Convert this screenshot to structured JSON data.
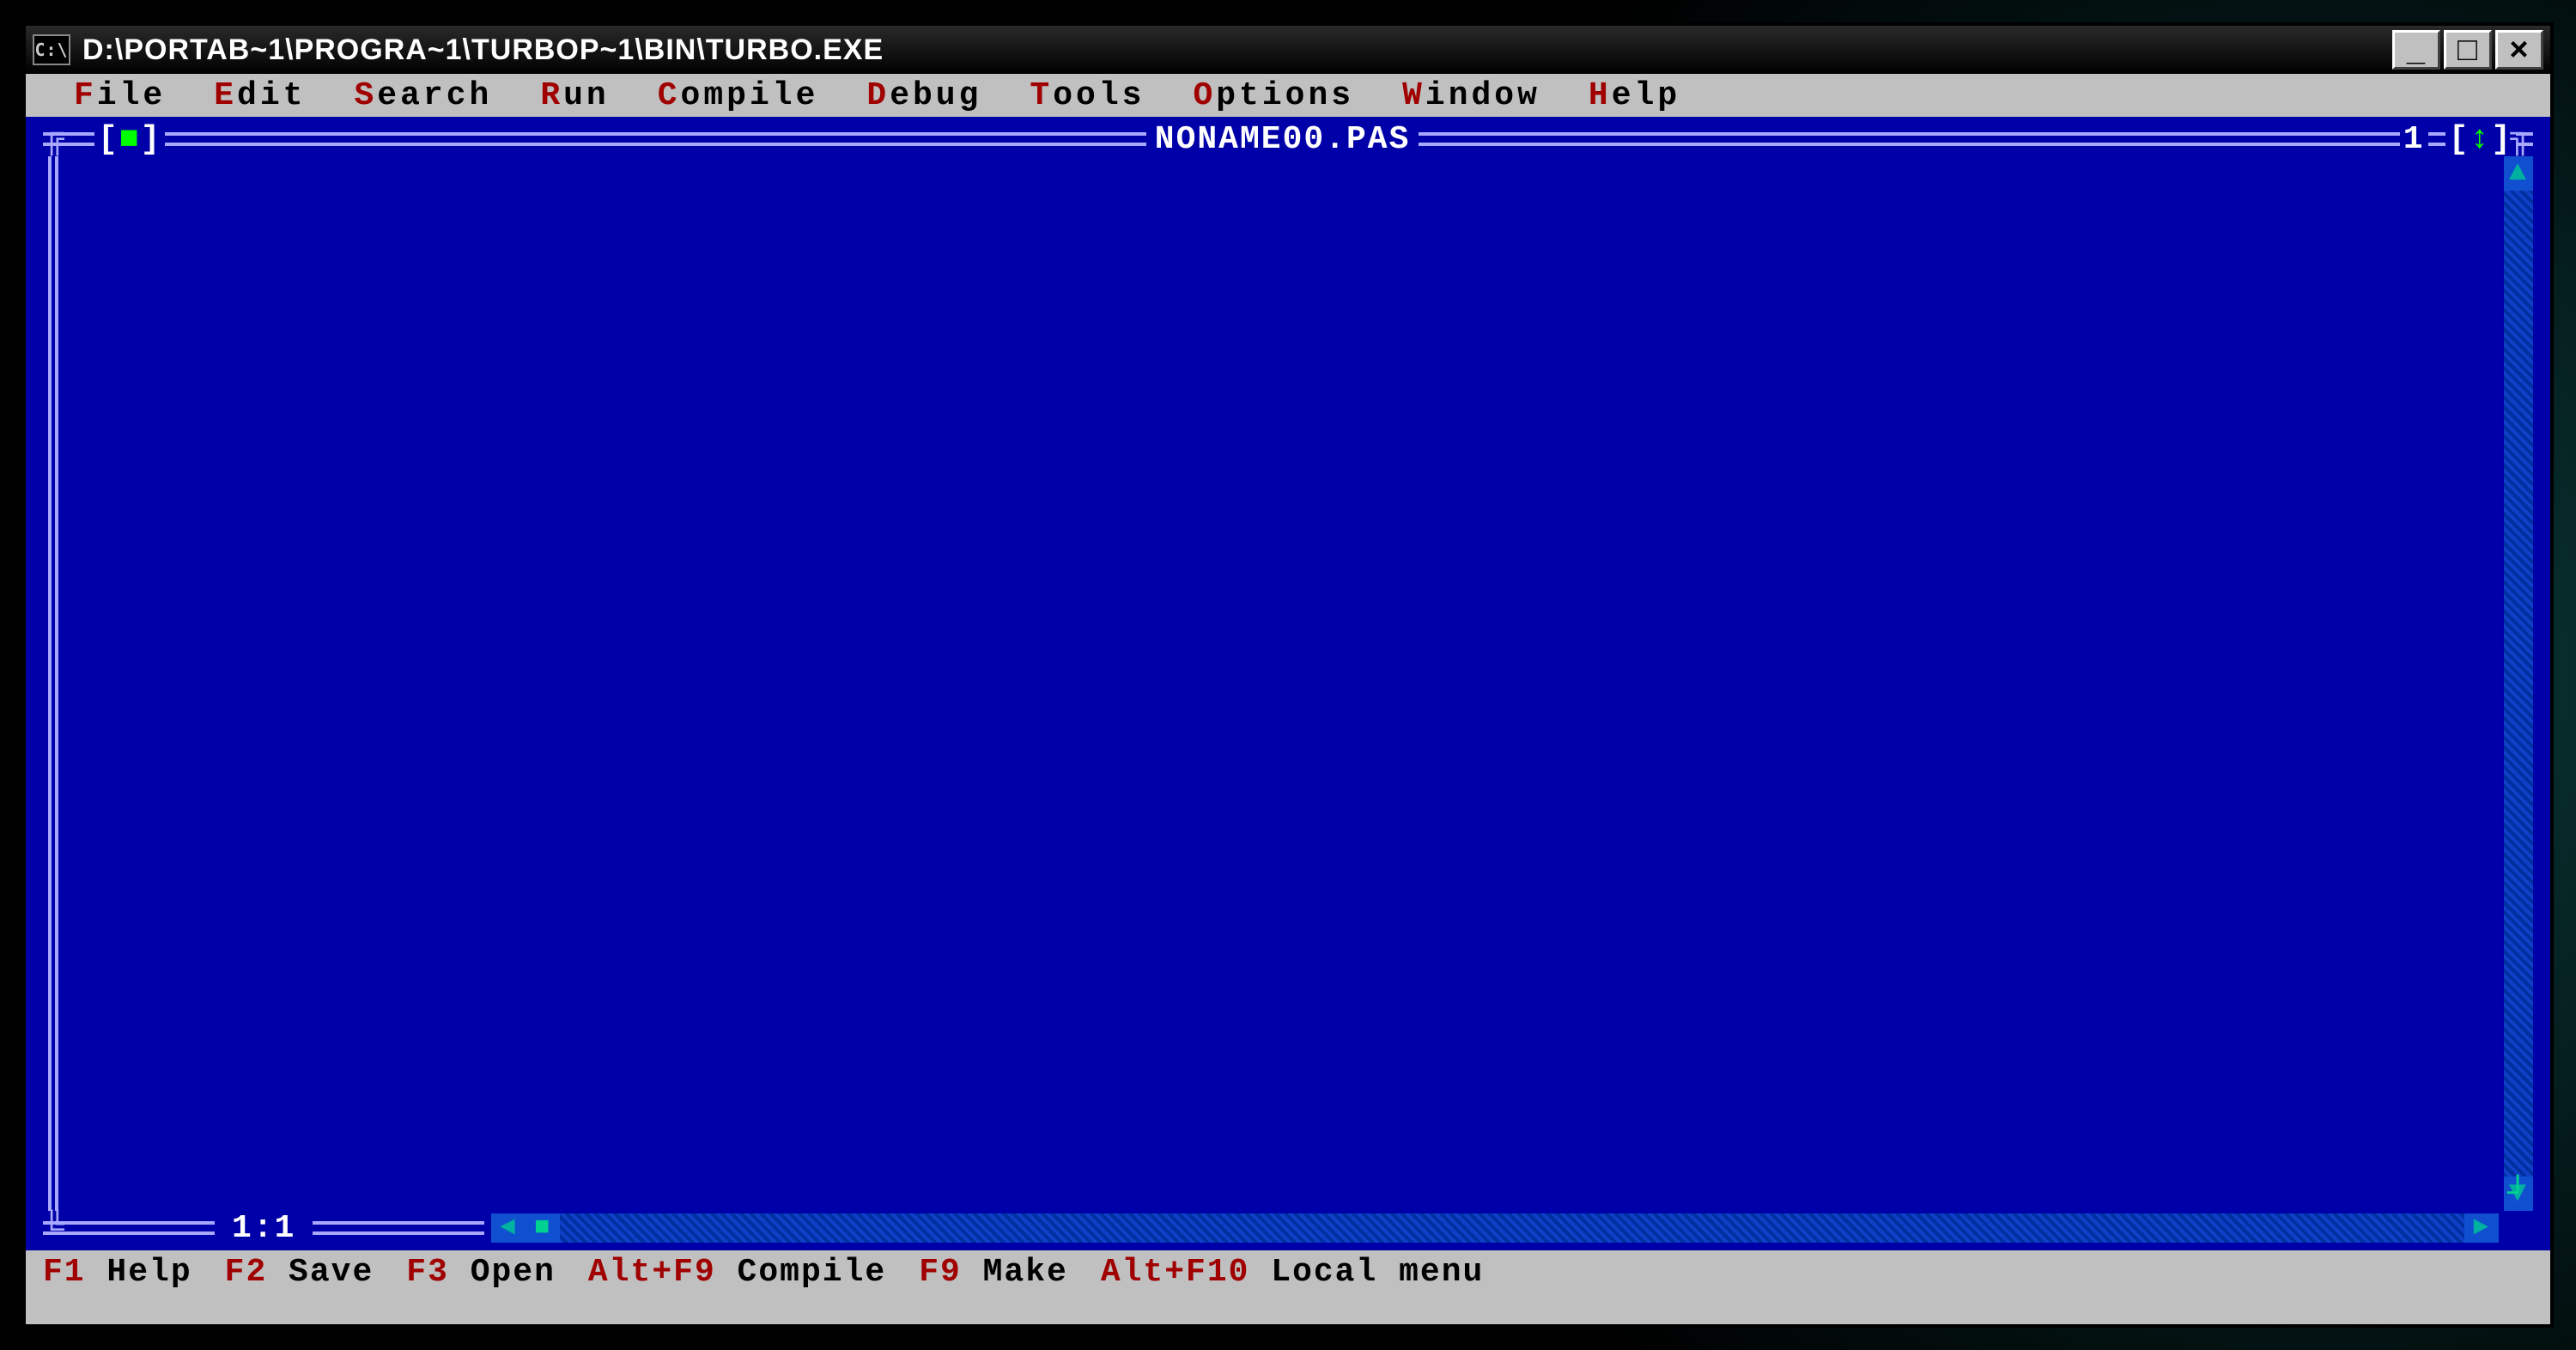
{
  "window": {
    "title": "D:\\PORTAB~1\\PROGRA~1\\TURBOP~1\\BIN\\TURBO.EXE",
    "sysicon_text": "C:\\",
    "min_glyph": "_",
    "max_glyph": "□",
    "close_glyph": "×"
  },
  "menu": {
    "items": [
      {
        "hotkey": "F",
        "rest": "ile"
      },
      {
        "hotkey": "E",
        "rest": "dit"
      },
      {
        "hotkey": "S",
        "rest": "earch"
      },
      {
        "hotkey": "R",
        "rest": "un"
      },
      {
        "hotkey": "C",
        "rest": "ompile"
      },
      {
        "hotkey": "D",
        "rest": "ebug"
      },
      {
        "hotkey": "T",
        "rest": "ools"
      },
      {
        "hotkey": "O",
        "rest": "ptions"
      },
      {
        "hotkey": "W",
        "rest": "indow"
      },
      {
        "hotkey": "H",
        "rest": "elp"
      }
    ]
  },
  "editor": {
    "close_l": "[",
    "close_sq": "■",
    "close_r": "]",
    "filename": "NONAME00.PAS",
    "window_number": "1",
    "zoom_l": "[",
    "zoom_arrow": "↕",
    "zoom_r": "]",
    "cursor_pos": "1:1",
    "scroll_up": "▲",
    "scroll_down": "▼",
    "scroll_left": "◄",
    "scroll_right": "►",
    "thumb": "■",
    "resize_corner": "┘"
  },
  "statusbar": {
    "items": [
      {
        "key": "F1",
        "label": " Help"
      },
      {
        "key": "F2",
        "label": " Save"
      },
      {
        "key": "F3",
        "label": " Open"
      },
      {
        "key": "Alt+F9",
        "label": " Compile"
      },
      {
        "key": "F9",
        "label": " Make"
      },
      {
        "key": "Alt+F10",
        "label": " Local menu"
      }
    ]
  }
}
